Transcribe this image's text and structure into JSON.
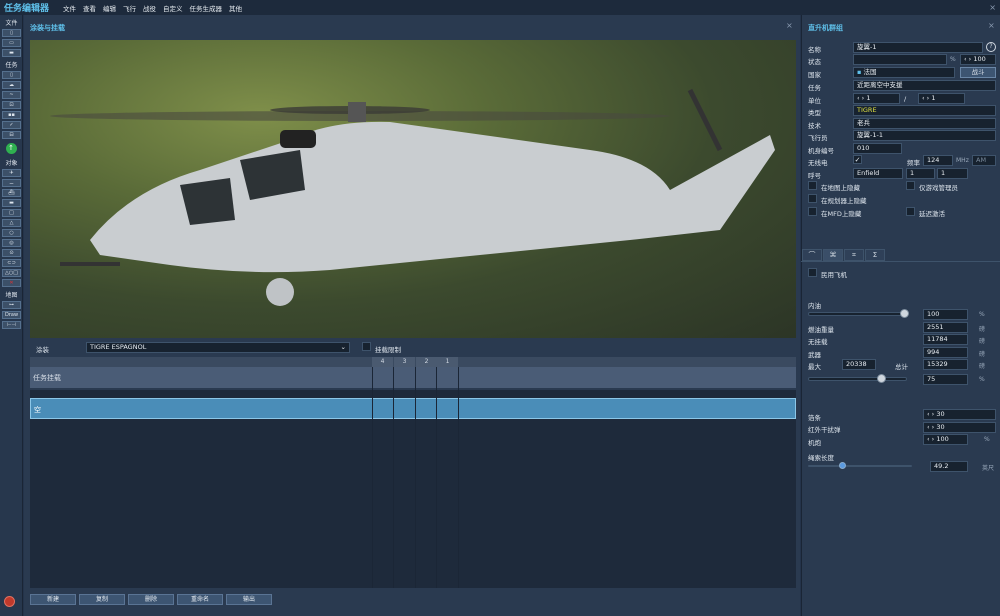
{
  "app": {
    "title": "任务编辑器",
    "menu": [
      "文件",
      "查看",
      "编辑",
      "飞行",
      "战役",
      "自定义",
      "任务生成器",
      "其他"
    ]
  },
  "leftbar": {
    "sections": [
      {
        "label": "文件",
        "buttons": [
          "new-icon",
          "open-icon",
          "save-icon"
        ]
      },
      {
        "label": "任务",
        "buttons": [
          "briefing-icon",
          "weather-icon",
          "goals-icon",
          "triggers-icon",
          "resources-icon",
          "check-icon",
          "options-icon"
        ]
      },
      {
        "label": "对象",
        "buttons": [
          "plane-icon",
          "helicopter-icon",
          "ship-icon",
          "vehicle-icon",
          "static-icon",
          "warehouse-icon",
          "airfield-icon",
          "target-icon",
          "zone-icon",
          "template-icon",
          "shapes-icon",
          "delete-icon"
        ]
      },
      {
        "label": "地图",
        "buttons": [
          "ruler-icon",
          "Draw",
          "measure-icon"
        ]
      }
    ]
  },
  "center": {
    "title": "涂装与挂载",
    "livery_label": "涂装",
    "livery_value": "TIGRE ESPAGNOL",
    "payload_limit_label": "挂载限制",
    "pylon_columns": [
      "4",
      "3",
      "2",
      "1"
    ],
    "task_row_label": "任务挂载",
    "selected_row_label": "空",
    "buttons": [
      "新建",
      "复制",
      "删除",
      "重命名",
      "输出"
    ]
  },
  "right": {
    "title": "直升机群组",
    "name_label": "名称",
    "name_value": "旋翼-1",
    "condition_label": "状态",
    "condition_unit": "%",
    "condition_value": "100",
    "country_label": "国家",
    "country_value": "法国",
    "combat_button": "战斗",
    "task_label": "任务",
    "task_value": "近距离空中支援",
    "unit_label": "单位",
    "unit_value": "1",
    "unit_sep": "/",
    "unit_total": "1",
    "type_label": "类型",
    "type_value": "TIGRE",
    "skill_label": "技术",
    "skill_value": "老兵",
    "pilot_label": "飞行员",
    "pilot_value": "旋翼-1-1",
    "tail_label": "机身编号",
    "tail_value": "010",
    "radio_label": "无线电",
    "freq_label": "频率",
    "freq_value": "124",
    "freq_unit": "MHz",
    "mod_value": "AM",
    "callsign_label": "呼号",
    "callsign_value": "Enfield",
    "callsign_n1": "1",
    "callsign_n2": "1",
    "hide_map": "在地图上隐藏",
    "game_master_only": "仅游戏管理员",
    "hide_planner": "在规划器上隐藏",
    "hide_mfd": "在MFD上隐藏",
    "late_activation": "延迟激活",
    "tabs": [
      "route-icon",
      "payload-icon",
      "triggered-actions-icon",
      "summary-icon"
    ],
    "civil_label": "民用飞机",
    "fuel_label": "内油",
    "fuel_percent": "100",
    "fuel_pct_fraction": 1.0,
    "percent": "%",
    "fuel_weight_label": "燃油重量",
    "fuel_weight": "2551",
    "empty_label": "无挂载",
    "empty_weight": "11784",
    "weapons_label": "武器",
    "weapons_weight": "994",
    "max_label": "最大",
    "max_weight": "20338",
    "total_label": "总计",
    "total_weight": "15329",
    "weight_unit": "磅",
    "load_percent": "75",
    "load_fraction": 0.75,
    "chaff_label": "箔条",
    "chaff_value": "30",
    "flare_label": "红外干扰弹",
    "flare_value": "30",
    "gun_label": "机炮",
    "gun_value": "100",
    "rope_label": "绳索长度",
    "rope_value": "49.2",
    "rope_unit": "英尺",
    "rope_fraction": 0.3
  }
}
